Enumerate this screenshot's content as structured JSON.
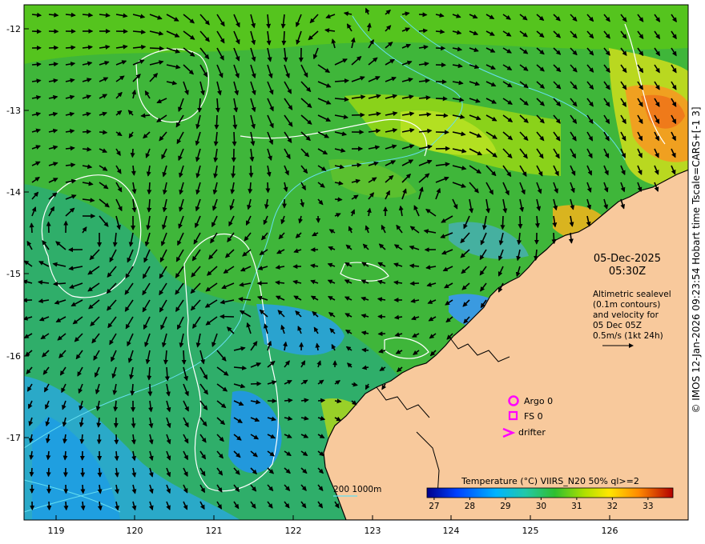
{
  "map": {
    "x_ticks": [
      "119",
      "120",
      "121",
      "122",
      "123",
      "124",
      "125",
      "126"
    ],
    "y_ticks": [
      "-12",
      "-13",
      "-14",
      "-15",
      "-16",
      "-17"
    ],
    "date": "05-Dec-2025",
    "time": "05:30Z",
    "info_lines": [
      "Altimetric sealevel",
      "(0.1m contours)",
      "and velocity for",
      "05 Dec 05Z",
      "0.5m/s (1kt 24h)"
    ],
    "legend": {
      "argo": "Argo 0",
      "fs": "FS 0",
      "drifter": "drifter",
      "argo_color": "#ff00ff"
    },
    "contour_key": "200  1000m",
    "colorbar": {
      "title": "Temperature (°C) VIIRS_N20 50% ql>=2",
      "ticks": [
        "27",
        "28",
        "29",
        "30",
        "31",
        "32",
        "33"
      ],
      "min": 26.8,
      "max": 33.7
    },
    "credit": "© IMOS 12-Jan-2026 09:23:54 Hobart time Tscale=CARS+[-1 3]",
    "colors": {
      "land": "#f8c99c",
      "sea_warm": "#35b23a",
      "sea_cool": "#24a8dc",
      "contour_depth": "#66dff0",
      "contour_sla": "#ffffff"
    }
  }
}
